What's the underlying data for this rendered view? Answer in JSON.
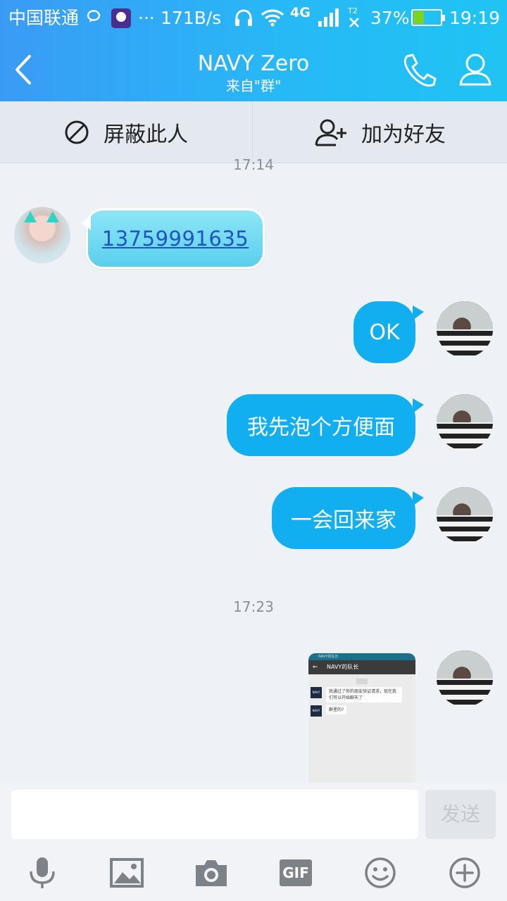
{
  "status_bar": {
    "carrier": "中国联通",
    "dots": "···",
    "net_speed": "171B/s",
    "network": "4G",
    "battery": "37%",
    "battery_level": 0.37,
    "time": "19:19",
    "battery_color": "#7ed321"
  },
  "header": {
    "title": "NAVY Zero",
    "subtitle": "来自\"群\"",
    "back_icon": "back-chevron-icon",
    "call_icon": "phone-icon",
    "profile_icon": "person-icon"
  },
  "actions": {
    "block_label": "屏蔽此人",
    "add_friend_label": "加为好友"
  },
  "messages": {
    "timestamp_1": "17:14",
    "incoming_1": "13759991635",
    "outgoing_1": "OK",
    "outgoing_2": "我先泡个方便面",
    "outgoing_3": "一会回来家",
    "timestamp_2": "17:23",
    "image_message": {
      "top_text": "NAVY的队长",
      "title": "NAVY的队长",
      "icon_text": "NAVY",
      "line_1": "我通过了你的朋友验证请求，现在我们可以开始聊天了",
      "line_2": "群里的?"
    }
  },
  "composer": {
    "input_value": "",
    "send_label": "发送",
    "gif_label": "GIF",
    "tools": [
      "microphone-icon",
      "image-icon",
      "camera-icon",
      "gif-icon",
      "emoji-icon",
      "plus-icon"
    ]
  },
  "colors": {
    "header_gradient_start": "#3a9bf5",
    "header_gradient_end": "#1fc4f3",
    "outgoing_bubble": "#12aff0",
    "incoming_bubble": "#5bcfee",
    "link": "#1f53c8"
  }
}
